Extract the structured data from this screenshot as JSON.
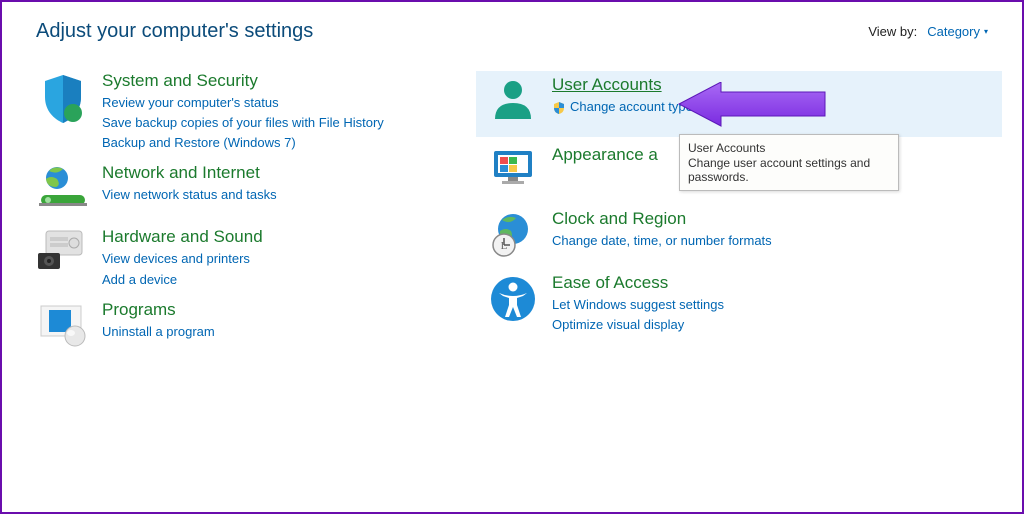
{
  "header": {
    "title": "Adjust your computer's settings",
    "view_by_label": "View by:",
    "view_by_value": "Category"
  },
  "left_categories": {
    "system_security": {
      "title": "System and Security",
      "links": [
        "Review your computer's status",
        "Save backup copies of your files with File History",
        "Backup and Restore (Windows 7)"
      ]
    },
    "network": {
      "title": "Network and Internet",
      "links": [
        "View network status and tasks"
      ]
    },
    "hardware": {
      "title": "Hardware and Sound",
      "links": [
        "View devices and printers",
        "Add a device"
      ]
    },
    "programs": {
      "title": "Programs",
      "links": [
        "Uninstall a program"
      ]
    }
  },
  "right_categories": {
    "user_accounts": {
      "title": "User Accounts",
      "links": [
        "Change account type"
      ]
    },
    "appearance": {
      "title": "Appearance a"
    },
    "clock": {
      "title": "Clock and Region",
      "links": [
        "Change date, time, or number formats"
      ]
    },
    "ease": {
      "title": "Ease of Access",
      "links": [
        "Let Windows suggest settings",
        "Optimize visual display"
      ]
    }
  },
  "tooltip": {
    "title": "User Accounts",
    "body": "Change user account settings and passwords."
  },
  "colors": {
    "heading_green": "#1b7a2d",
    "link_blue": "#0066b3",
    "highlight_bg": "#e6f2fb",
    "arrow_purple": "#8a3cf0"
  }
}
